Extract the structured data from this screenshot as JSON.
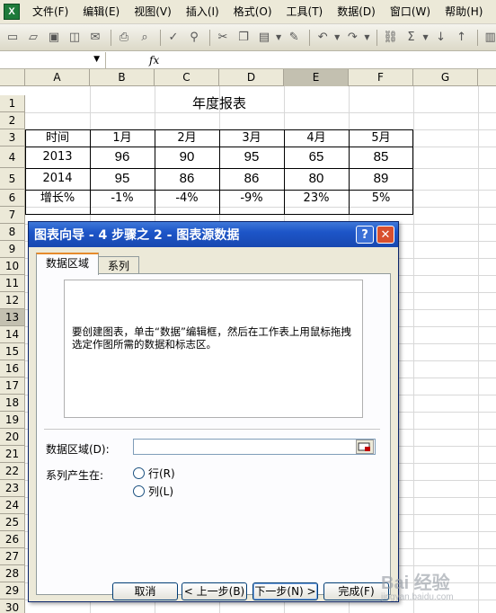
{
  "menu": {
    "items": [
      {
        "label": "文件(F)"
      },
      {
        "label": "编辑(E)"
      },
      {
        "label": "视图(V)"
      },
      {
        "label": "插入(I)"
      },
      {
        "label": "格式(O)"
      },
      {
        "label": "工具(T)"
      },
      {
        "label": "数据(D)"
      },
      {
        "label": "窗口(W)"
      },
      {
        "label": "帮助(H)"
      }
    ]
  },
  "formula_bar": {
    "fx": "fx"
  },
  "sheet": {
    "columns": [
      "A",
      "B",
      "C",
      "D",
      "E",
      "F",
      "G"
    ],
    "selected_column": "E",
    "rows": [
      "1",
      "2",
      "3",
      "4",
      "5",
      "6",
      "7",
      "8",
      "9",
      "10",
      "11",
      "12",
      "13",
      "14",
      "15",
      "16",
      "17",
      "18",
      "19",
      "20",
      "21",
      "22",
      "23",
      "24",
      "25",
      "26",
      "27",
      "28",
      "29",
      "30"
    ],
    "selected_row": "13",
    "title": "年度报表",
    "table": {
      "header": [
        "时间",
        "1月",
        "2月",
        "3月",
        "4月",
        "5月"
      ],
      "row_2013": [
        "2013",
        "96",
        "90",
        "95",
        "65",
        "85"
      ],
      "row_2014": [
        "2014",
        "95",
        "86",
        "86",
        "80",
        "89"
      ],
      "row_growth": [
        "增长%",
        "-1%",
        "-4%",
        "-9%",
        "23%",
        "5%"
      ]
    }
  },
  "dialog": {
    "title": "图表向导 - 4 步骤之 2 - 图表源数据",
    "help": "?",
    "close": "✕",
    "tabs": [
      {
        "label": "数据区域"
      },
      {
        "label": "系列"
      }
    ],
    "preview_text": "要创建图表，单击“数据”编辑框，然后在工作表上用鼠标拖拽选定作图所需的数据和标志区。",
    "range_label": "数据区域(D):",
    "range_value": "",
    "series_label": "系列产生在:",
    "radio_rows": "行(R)",
    "radio_cols": "列(L)",
    "buttons": {
      "cancel": "取消",
      "back": "< 上一步(B)",
      "next": "下一步(N) >",
      "finish": "完成(F)"
    }
  },
  "watermark": {
    "text": "Bai 经验",
    "sub": "jingyan.baidu.com"
  }
}
